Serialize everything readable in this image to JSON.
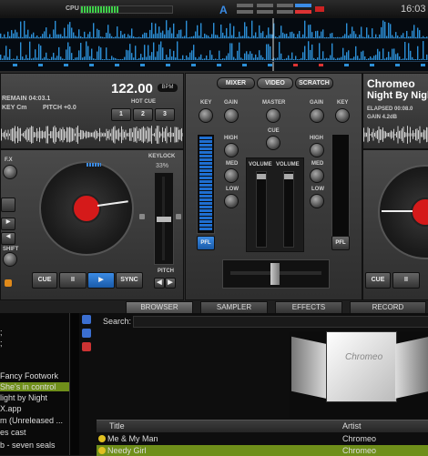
{
  "topbar": {
    "cpu_label": "CPU",
    "logo": "A",
    "clock": "16:03",
    "cpu_load_pct": 42
  },
  "left_deck": {
    "remain": "REMAIN 04:03.1",
    "key": "KEY Cm",
    "pitch": "PITCH +0.0",
    "bpm_value": "122.00",
    "bpm_unit": "BPM",
    "hotcue_label": "HOT CUE",
    "hotcues": [
      "1",
      "2",
      "3"
    ],
    "keylock_label": "KEYLOCK",
    "keylock_pct": "33%",
    "pitch_label": "PITCH",
    "fx_label": "F.X",
    "shift_label": "SHIFT",
    "transport": {
      "cue": "CUE",
      "pause": "II",
      "play": "▶",
      "sync": "SYNC"
    }
  },
  "mixer": {
    "tabs": [
      "MIXER",
      "VIDEO",
      "SCRATCH"
    ],
    "key": "KEY",
    "gain": "GAIN",
    "master": "MASTER",
    "cue": "CUE",
    "high": "HIGH",
    "med": "MED",
    "low": "LOW",
    "volume": "VOLUME",
    "pfl": "PFL"
  },
  "right_deck": {
    "artist": "Chromeo",
    "title": "Night By Night",
    "elapsed": "ELAPSED 00:08.0",
    "gain": "GAIN 4.2dB",
    "transport": {
      "cue": "CUE",
      "pause": "II"
    }
  },
  "tabs": [
    "BROWSER",
    "SAMPLER",
    "EFFECTS",
    "RECORD"
  ],
  "browser": {
    "search_label": "Search:",
    "tree_items": [
      ";",
      ";",
      "Fancy Footwork",
      "She's in control",
      "light by Night",
      "X.app",
      "m (Unreleased ...",
      "es cast",
      "b - seven seals"
    ],
    "columns": {
      "title": "Title",
      "artist": "Artist"
    },
    "rows": [
      {
        "title": "Me & My Man",
        "artist": "Chromeo"
      },
      {
        "title": "Needy Girl",
        "artist": "Chromeo"
      }
    ],
    "cover_text": "Chromeo"
  }
}
